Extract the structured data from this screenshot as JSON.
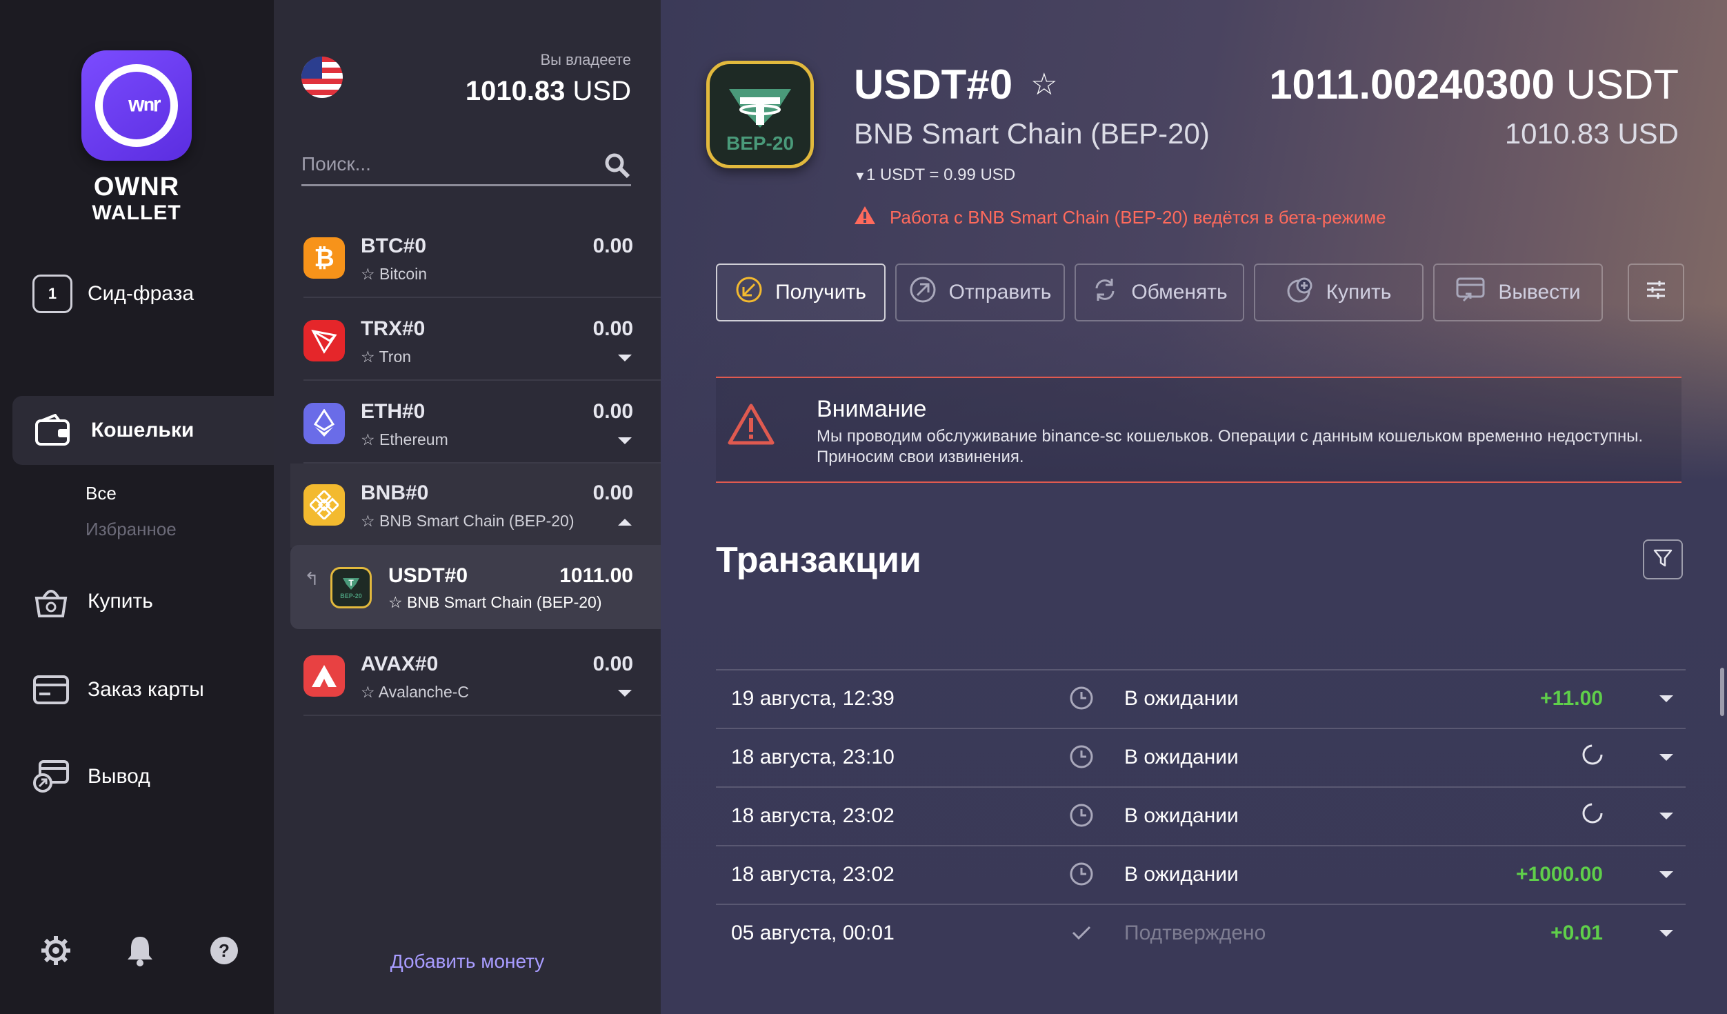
{
  "brand": {
    "line1": "OWNR",
    "line2": "WALLET",
    "logo_mark": "ʷⁿʳ"
  },
  "sidebar": {
    "seed": {
      "badge": "1",
      "label": "Сид-фраза"
    },
    "wallets": {
      "label": "Кошельки",
      "sub": {
        "all": "Все",
        "favorites": "Избранное"
      }
    },
    "buy": "Купить",
    "card_order": "Заказ карты",
    "withdraw": "Вывод",
    "bottom_icons": [
      "gear-icon",
      "bell-icon",
      "help-icon"
    ]
  },
  "portfolio": {
    "label": "Вы владеете",
    "value": "1010.83",
    "currency": "USD"
  },
  "search": {
    "placeholder": "Поиск..."
  },
  "coins": [
    {
      "name": "BTC#0",
      "chain": "Bitcoin",
      "balance": "0.00",
      "icon": "bitcoin-icon",
      "color": "#f7931a"
    },
    {
      "name": "TRX#0",
      "chain": "Tron",
      "balance": "0.00",
      "icon": "tron-icon",
      "color": "#e5262a"
    },
    {
      "name": "ETH#0",
      "chain": "Ethereum",
      "balance": "0.00",
      "icon": "ethereum-icon",
      "color": "#6a6ce8"
    },
    {
      "name": "BNB#0",
      "chain": "BNB Smart Chain (BEP-20)",
      "balance": "0.00",
      "icon": "bnb-icon",
      "color": "#f3ba2f"
    },
    {
      "name": "USDT#0",
      "chain": "BNB Smart Chain (BEP-20)",
      "balance": "1011.00",
      "icon": "usdt-bep20-icon"
    },
    {
      "name": "AVAX#0",
      "chain": "Avalanche-C",
      "balance": "0.00",
      "icon": "avalanche-icon",
      "color": "#e84142"
    }
  ],
  "add_coin": "Добавить монету",
  "token": {
    "title": "USDT#0",
    "badge_text": "BEP-20",
    "chain": "BNB Smart Chain (BEP-20)",
    "rate": "1 USDT = 0.99 USD",
    "beta_warning": "Работа с BNB Smart Chain (BEP-20) ведётся в бета-режиме",
    "balance": "1011.00240300",
    "balance_unit": "USDT",
    "balance_usd": "1010.83 USD"
  },
  "actions": {
    "receive": "Получить",
    "send": "Отправить",
    "exchange": "Обменять",
    "buy": "Купить",
    "withdraw": "Вывести"
  },
  "alert": {
    "title": "Внимание",
    "text": "Мы проводим обслуживание binance-sc кошельков. Операции с данным кошельком временно недоступны. Приносим свои извинения."
  },
  "transactions": {
    "title": "Транзакции",
    "rows": [
      {
        "date": "19 августа, 12:39",
        "status": "В ожидании",
        "amount": "+11.00"
      },
      {
        "date": "18 августа, 23:10",
        "status": "В ожидании",
        "amount": ""
      },
      {
        "date": "18 августа, 23:02",
        "status": "В ожидании",
        "amount": ""
      },
      {
        "date": "18 августа, 23:02",
        "status": "В ожидании",
        "amount": "+1000.00"
      },
      {
        "date": "05 августа, 00:01",
        "status": "Подтверждено",
        "amount": "+0.01"
      }
    ]
  },
  "colors": {
    "accent": "#7b4cff",
    "positive": "#5fcf4a",
    "warning": "#e05a50",
    "gold": "#e2b93d"
  }
}
